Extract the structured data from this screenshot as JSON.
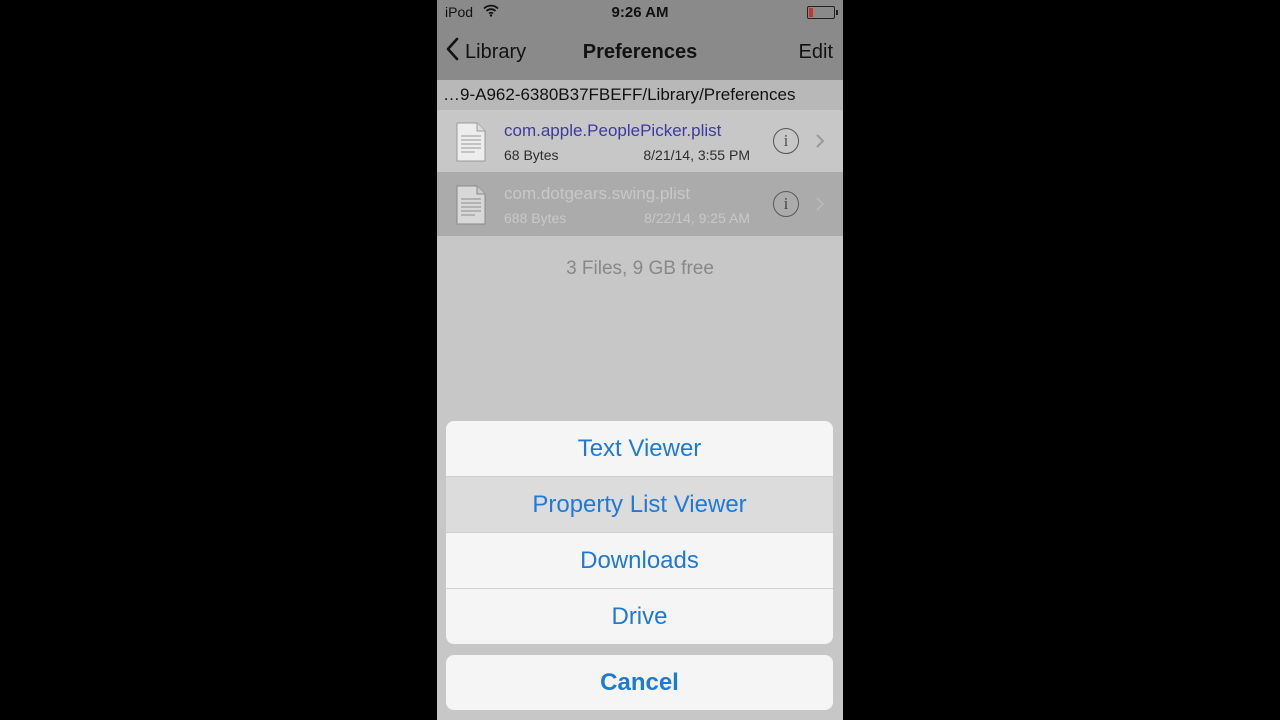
{
  "status_bar": {
    "carrier": "iPod",
    "time": "9:26 AM",
    "battery_level": 0.15
  },
  "nav": {
    "back_label": "Library",
    "title": "Preferences",
    "edit_label": "Edit"
  },
  "path": "…9-A962-6380B37FBEFF/Library/Preferences",
  "files": [
    {
      "name": "com.apple.PeoplePicker.plist",
      "size": "68 Bytes",
      "date": "8/21/14, 3:55 PM",
      "info": "i"
    },
    {
      "name": "com.dotgears.swing.plist",
      "size": "688 Bytes",
      "date": "8/22/14, 9:25 AM",
      "info": "i"
    }
  ],
  "summary": "3 Files, 9 GB free",
  "action_sheet": {
    "items": [
      "Text Viewer",
      "Property List Viewer",
      "Downloads",
      "Drive"
    ],
    "cancel_label": "Cancel"
  },
  "colors": {
    "accent": "#1f7ad6",
    "file_name": "#3e3aa0"
  }
}
